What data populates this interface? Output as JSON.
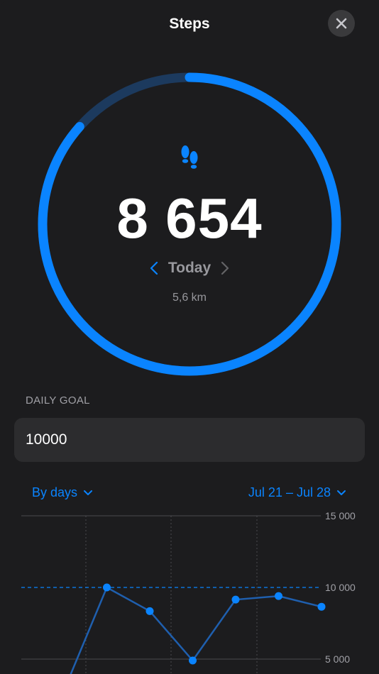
{
  "header": {
    "title": "Steps"
  },
  "ring": {
    "progress": 0.8654,
    "goal": 10000,
    "steps": 8654,
    "color": "#0a84ff",
    "track_color": "#1c3a5e"
  },
  "summary": {
    "step_count": "8 654",
    "day_label": "Today",
    "distance": "5,6 km"
  },
  "goal": {
    "label": "DAILY GOAL",
    "value": "10000"
  },
  "filters": {
    "period": "By days",
    "range": "Jul 21 – Jul 28"
  },
  "chart_data": {
    "type": "line",
    "y_tick_labels": [
      "15 000",
      "10 000",
      "5 000"
    ],
    "y_ticks": [
      15000,
      10000,
      5000
    ],
    "goal_line": 10000,
    "x": [
      0,
      1,
      2,
      3,
      4,
      5,
      6
    ],
    "values": [
      2800,
      10000,
      8350,
      4900,
      9150,
      9400,
      8654
    ],
    "ylim": [
      5000,
      15000
    ],
    "series_color": "#0a84ff"
  }
}
